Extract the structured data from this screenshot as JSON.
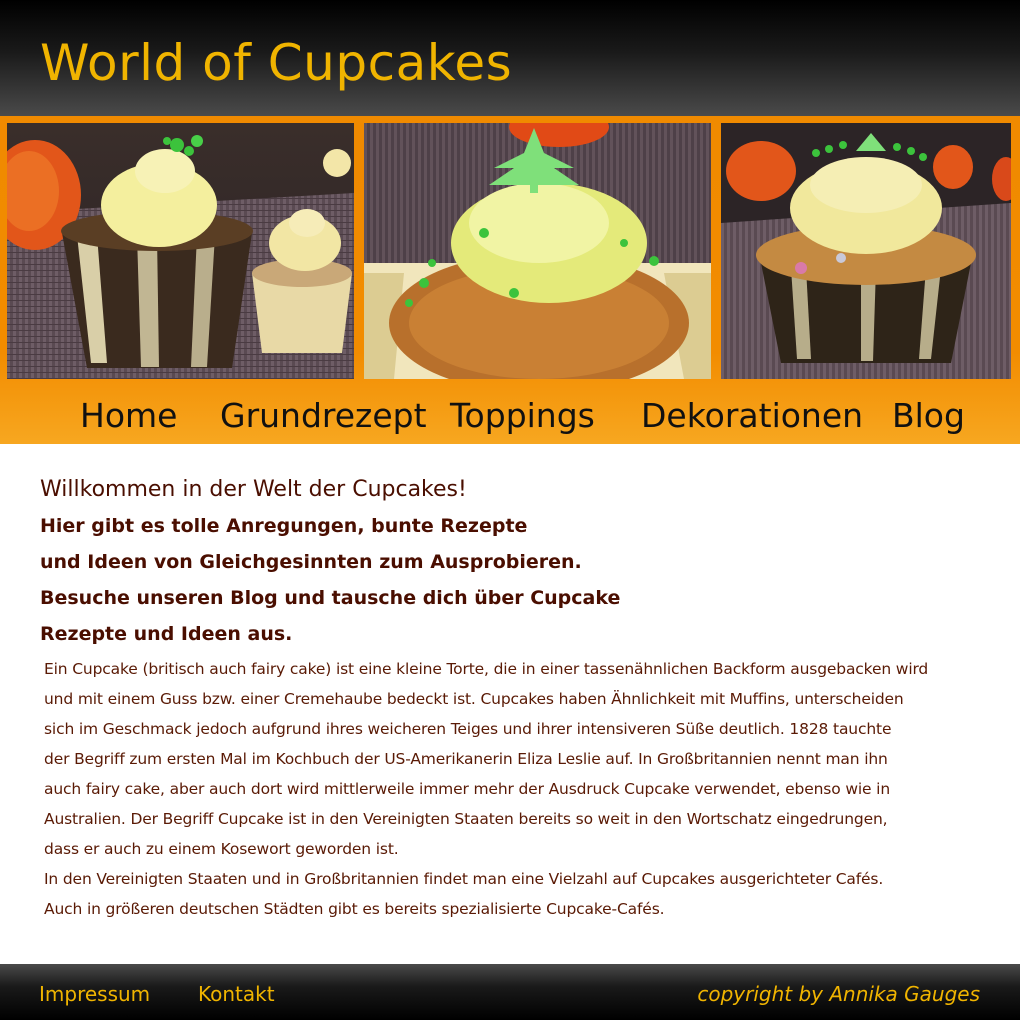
{
  "header": {
    "title": "World of Cupcakes"
  },
  "gallery": {
    "photos": [
      {
        "alt": "cupcake-photo-1"
      },
      {
        "alt": "cupcake-photo-2"
      },
      {
        "alt": "cupcake-photo-3"
      }
    ]
  },
  "nav": {
    "items": [
      {
        "label": "Home"
      },
      {
        "label": "Grundrezept"
      },
      {
        "label": "Toppings"
      },
      {
        "label": "Dekorationen"
      },
      {
        "label": "Blog"
      }
    ]
  },
  "content": {
    "heading": "Willkommen in der Welt der Cupcakes!",
    "intro": [
      "Hier gibt es tolle Anregungen, bunte Rezepte",
      "und Ideen von Gleichgesinnten zum Ausprobieren.",
      "Besuche unseren Blog und tausche dich über Cupcake",
      "Rezepte und Ideen aus."
    ],
    "body": [
      "Ein Cupcake (britisch auch fairy cake) ist eine kleine Torte, die in einer tassenähnlichen Backform ausgebacken wird",
      "und mit einem Guss bzw. einer Cremehaube bedeckt ist. Cupcakes haben Ähnlichkeit mit Muffins, unterscheiden",
      "sich im Geschmack jedoch aufgrund ihres weicheren Teiges und ihrer intensiveren Süße deutlich. 1828 tauchte",
      "der Begriff zum ersten Mal im Kochbuch der US-Amerikanerin Eliza Leslie auf. In Großbritannien nennt man ihn",
      "auch fairy cake, aber auch dort wird mittlerweile immer mehr der Ausdruck Cupcake verwendet, ebenso wie in",
      "Australien. Der Begriff Cupcake ist in den Vereinigten Staaten bereits so weit in den Wortschatz eingedrungen,",
      "dass er auch zu einem Kosewort geworden ist.",
      "In den Vereinigten Staaten und in Großbritannien findet man eine Vielzahl auf Cupcakes ausgerichteter Cafés.",
      "Auch in größeren deutschen Städten gibt es bereits spezialisierte Cupcake-Cafés."
    ]
  },
  "footer": {
    "impressum": "Impressum",
    "kontakt": "Kontakt",
    "copyright": "copyright by Annika Gauges"
  },
  "colors": {
    "accent": "#f0b400",
    "orange": "#f28c00",
    "text_dark": "#4a0e00"
  }
}
